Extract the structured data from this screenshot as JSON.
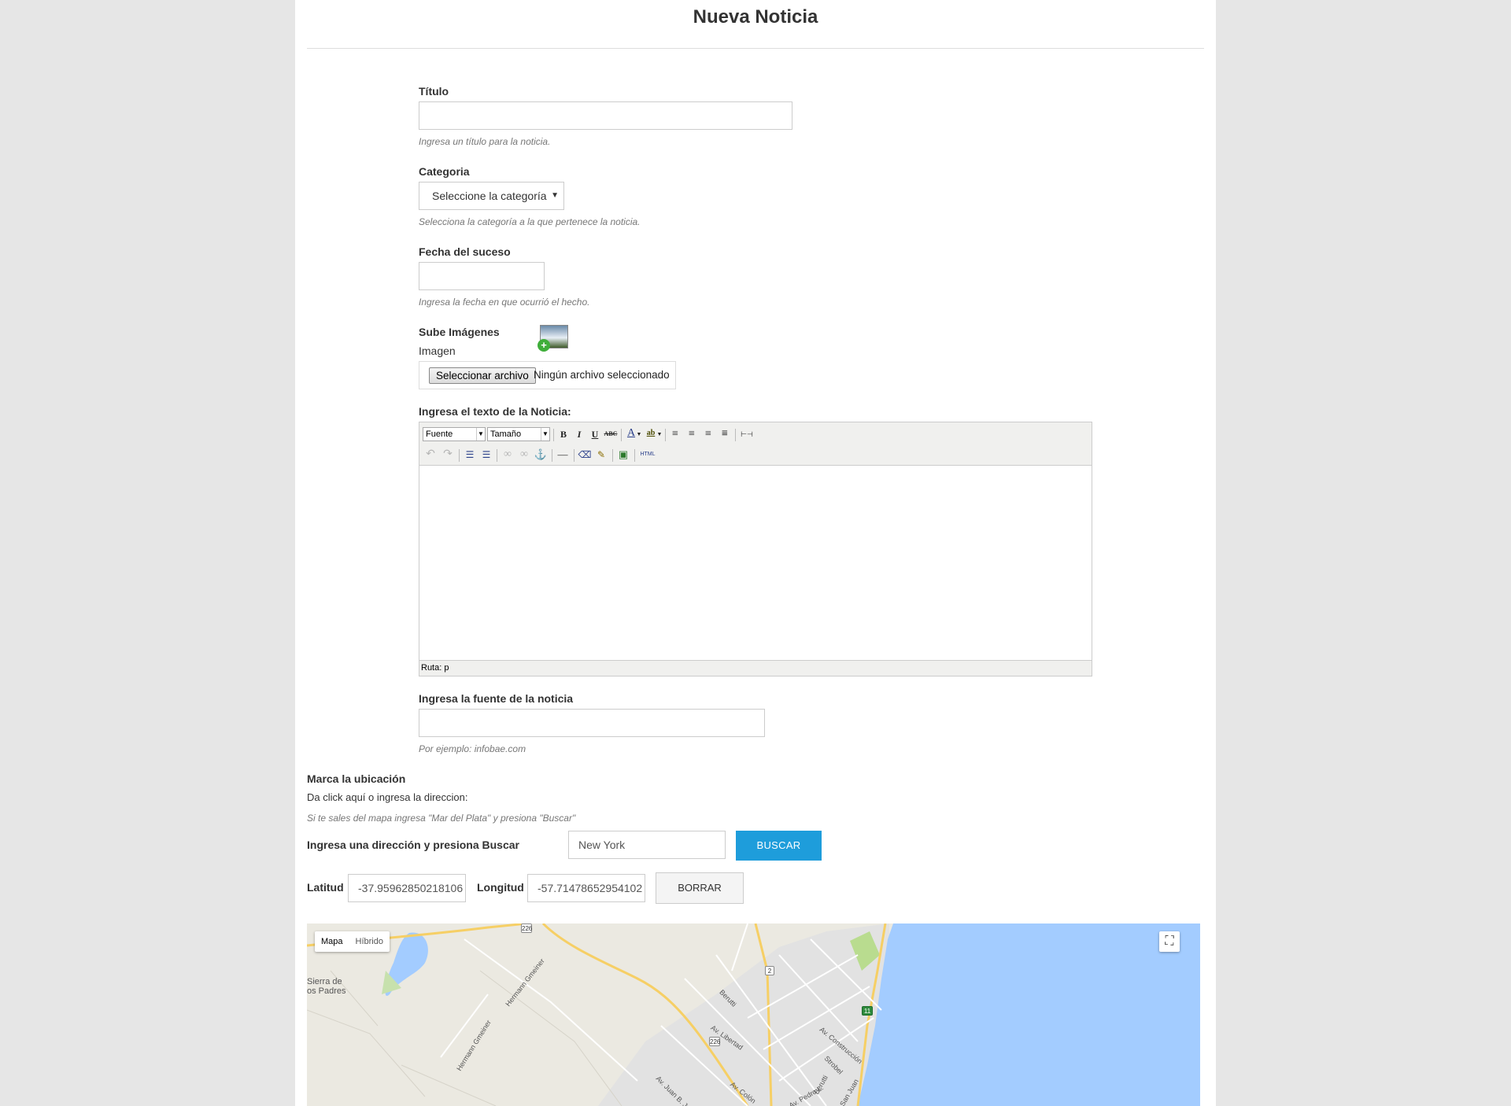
{
  "page": {
    "title": "Nueva Noticia"
  },
  "form": {
    "titulo": {
      "label": "Título",
      "value": "",
      "help": "Ingresa un título para la noticia."
    },
    "categoria": {
      "label": "Categoria",
      "selected": "Seleccione la categoría",
      "help": "Selecciona la categoría a la que pertenece la noticia."
    },
    "fecha": {
      "label": "Fecha del suceso",
      "value": "",
      "help": "Ingresa la fecha en que ocurrió el hecho."
    },
    "imagenes": {
      "label": "Sube Imágenes",
      "sublabel": "Imagen",
      "file_button": "Seleccionar archivo",
      "file_status": "Ningún archivo seleccionado",
      "icon": "add-image-icon"
    },
    "texto": {
      "label": "Ingresa el texto de la Noticia:"
    },
    "fuente": {
      "label": "Ingresa la fuente de la noticia",
      "value": "",
      "help": "Por ejemplo: infobae.com"
    }
  },
  "editor": {
    "font_select": "Fuente",
    "size_select": "Tamaño",
    "statusbar": "Ruta: p",
    "buttons_row1": [
      {
        "name": "bold",
        "glyph": "B"
      },
      {
        "name": "italic",
        "glyph": "I"
      },
      {
        "name": "underline",
        "glyph": "U"
      },
      {
        "name": "strikethrough",
        "glyph": "ABC"
      },
      {
        "name": "text-color",
        "glyph": "A"
      },
      {
        "name": "highlight-color",
        "glyph": "ab"
      },
      {
        "name": "align-left",
        "glyph": "≡"
      },
      {
        "name": "align-center",
        "glyph": "≡"
      },
      {
        "name": "align-right",
        "glyph": "≡"
      },
      {
        "name": "align-justify",
        "glyph": "≡"
      },
      {
        "name": "page-break",
        "glyph": "⊢⊣"
      }
    ],
    "buttons_row2": [
      {
        "name": "undo",
        "glyph": "↶"
      },
      {
        "name": "redo",
        "glyph": "↷"
      },
      {
        "name": "bullet-list",
        "glyph": "☰"
      },
      {
        "name": "numbered-list",
        "glyph": "☰"
      },
      {
        "name": "link",
        "glyph": "∞"
      },
      {
        "name": "unlink",
        "glyph": "∞"
      },
      {
        "name": "anchor",
        "glyph": "⚓"
      },
      {
        "name": "horizontal-rule",
        "glyph": "—"
      },
      {
        "name": "remove-format",
        "glyph": "⌫"
      },
      {
        "name": "cleanup",
        "glyph": "✎"
      },
      {
        "name": "insert-image",
        "glyph": "▣"
      },
      {
        "name": "html",
        "glyph": "HTML"
      }
    ]
  },
  "location": {
    "heading": "Marca la ubicación",
    "instruction": "Da click aquí o ingresa la direccion:",
    "hint": "Si te sales del mapa ingresa \"Mar del Plata\" y presiona \"Buscar\"",
    "search_label": "Ingresa una dirección y presiona Buscar",
    "search_value": "New York",
    "search_button": "BUSCAR",
    "lat_label": "Latitud",
    "lat_value": "-37.95962850218106",
    "lng_label": "Longitud",
    "lng_value": "-57.71478652954102",
    "clear_button": "BORRAR"
  },
  "map": {
    "type_options": [
      "Mapa",
      "Híbrido"
    ],
    "selected_type": "Mapa",
    "fullscreen_icon": "fullscreen-icon",
    "labels": {
      "sierra1": "Sierra de",
      "sierra2": "os Padres",
      "gmeiner1": "Hermann Gmeiner",
      "gmeiner2": "Hermann Gmeiner",
      "berutti": "Berutti",
      "libertad": "Av. Libertad",
      "construccion": "Av. Construcción",
      "strobel": "Strobel",
      "berutti2": "Berutti",
      "justo": "Av. Juan B. Justo",
      "colon": "Av. Colón",
      "pedro": "Av. Pedro L.",
      "sanjuan": "San Juan"
    },
    "shields": {
      "r226a": "226",
      "r226b": "226",
      "r2": "2",
      "r11": "11"
    },
    "colors": {
      "land": "#ebe9e1",
      "water": "#a3ccff",
      "urban": "#d9d9d9",
      "park": "#b9dc8f"
    }
  },
  "colors": {
    "primary": "#1e9ddb",
    "background": "#e6e6e6"
  }
}
